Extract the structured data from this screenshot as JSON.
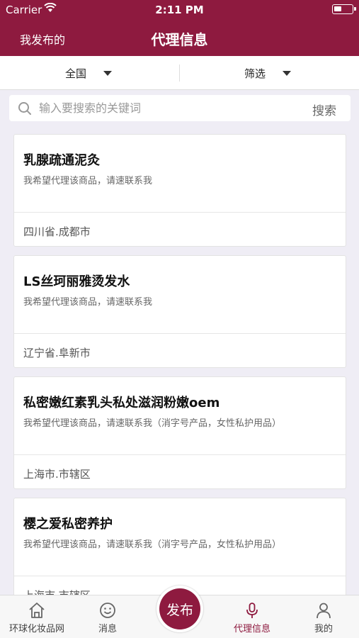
{
  "status": {
    "carrier": "Carrier",
    "time": "2:11 PM"
  },
  "nav": {
    "left_label": "我发布的",
    "title": "代理信息"
  },
  "filters": {
    "region": "全国",
    "screen": "筛选"
  },
  "search": {
    "placeholder": "输入要搜索的关键词",
    "button": "搜索"
  },
  "listings": [
    {
      "title": "乳腺疏通泥灸",
      "desc": "我希望代理该商品，请速联系我",
      "location": "四川省.成都市"
    },
    {
      "title": "LS丝珂丽雅烫发水",
      "desc": "我希望代理该商品，请速联系我",
      "location": "辽宁省.阜新市"
    },
    {
      "title": "私密嫩红素乳头私处滋润粉嫩oem",
      "desc": "我希望代理该商品，请速联系我（消字号产品，女性私护用品）",
      "location": "上海市.市辖区"
    },
    {
      "title": "樱之爱私密养护",
      "desc": "我希望代理该商品，请速联系我（消字号产品，女性私护用品）",
      "location": "上海市.市辖区"
    }
  ],
  "tabs": {
    "home": "环球化妆品网",
    "messages": "消息",
    "publish": "发布",
    "agent": "代理信息",
    "mine": "我的"
  },
  "colors": {
    "brand": "#8e1a3f",
    "background": "#efedf5"
  },
  "icons": {
    "status_wifi": "wifi-icon",
    "status_battery": "battery-icon",
    "filter_caret": "caret-down-icon",
    "search": "search-icon",
    "home": "home-icon",
    "messages": "smiley-icon",
    "agent": "microphone-icon",
    "mine": "person-icon"
  }
}
